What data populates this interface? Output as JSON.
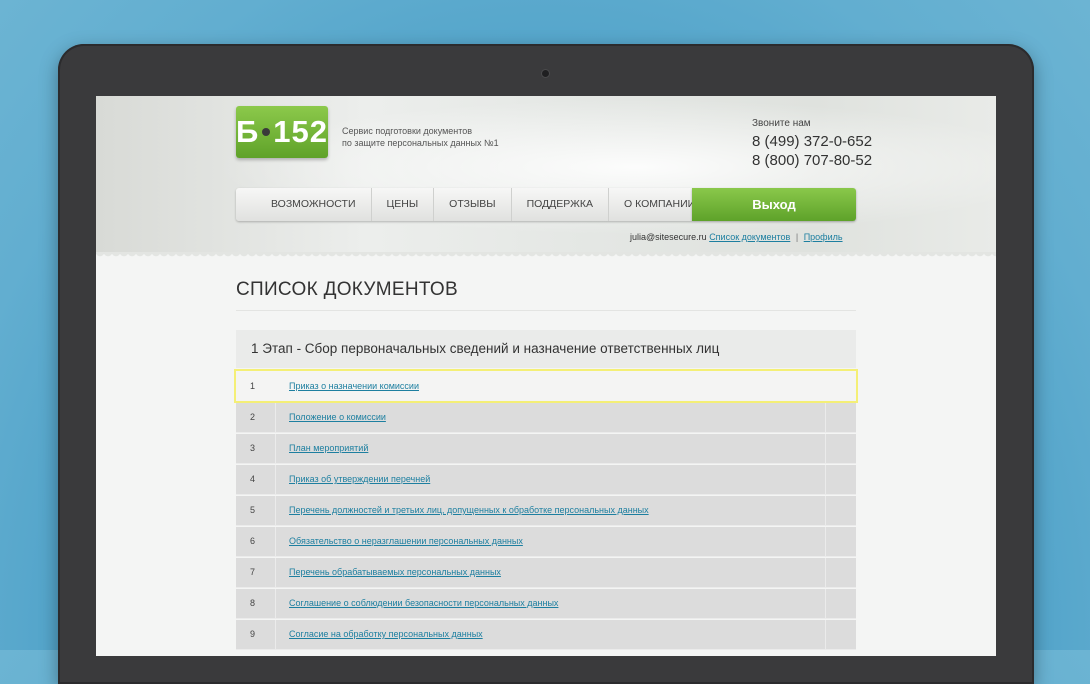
{
  "logo": {
    "left": "Б",
    "right": "152"
  },
  "tagline": {
    "line1": "Сервис подготовки документов",
    "line2": "по защите персональных данных №1"
  },
  "contacts": {
    "label": "Звоните нам",
    "phone1": "8 (499) 372-0-652",
    "phone2": "8 (800) 707-80-52"
  },
  "nav": {
    "items": [
      "ВОЗМОЖНОСТИ",
      "ЦЕНЫ",
      "ОТЗЫВЫ",
      "ПОДДЕРЖКА",
      "О КОМПАНИИ"
    ],
    "exit_label": "Выход"
  },
  "user": {
    "email": "julia@sitesecure.ru",
    "docs_link": "Список документов",
    "separator": "|",
    "profile_link": "Профиль"
  },
  "page": {
    "title": "СПИСОК ДОКУМЕНТОВ"
  },
  "stage": {
    "title": "1 Этап - Сбор первоначальных сведений и назначение ответственных лиц"
  },
  "documents": [
    {
      "num": "1",
      "title": "Приказ о назначении комиссии"
    },
    {
      "num": "2",
      "title": "Положение о комиссии"
    },
    {
      "num": "3",
      "title": "План мероприятий"
    },
    {
      "num": "4",
      "title": "Приказ об утверждении перечней"
    },
    {
      "num": "5",
      "title": "Перечень должностей и третьих лиц, допущенных к обработке персональных данных"
    },
    {
      "num": "6",
      "title": "Обязательство о неразглашении персональных данных"
    },
    {
      "num": "7",
      "title": "Перечень обрабатываемых персональных данных"
    },
    {
      "num": "8",
      "title": "Соглашение о соблюдении безопасности персональных данных"
    },
    {
      "num": "9",
      "title": "Согласие на обработку персональных данных"
    }
  ],
  "colors": {
    "brand_green": "#6cb335",
    "link_blue": "#1d7fa0",
    "highlight_yellow": "#f4ef76"
  }
}
